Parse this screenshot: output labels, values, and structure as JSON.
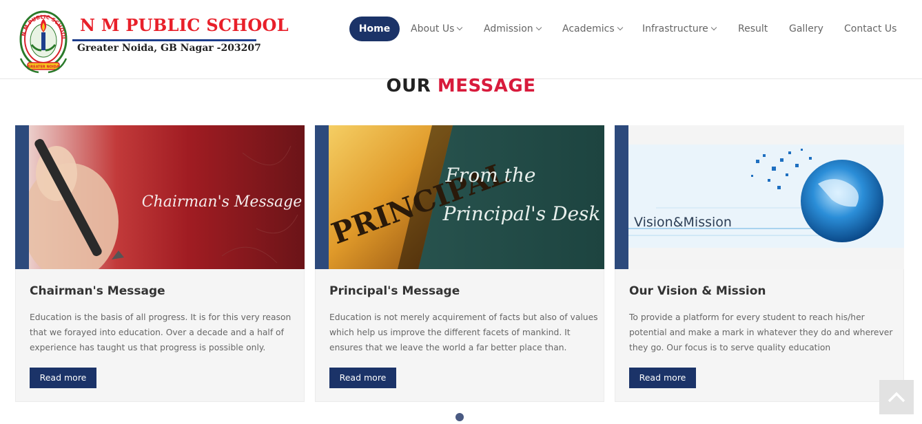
{
  "brand": {
    "name": "N M PUBLIC SCHOOL",
    "address": "Greater Noida, GB Nagar -203207",
    "emblem_text": "N M PUBLIC SCHOOL",
    "emblem_motto": "GREATER NOIDA"
  },
  "nav": {
    "items": [
      {
        "label": "Home",
        "active": true,
        "dropdown": false
      },
      {
        "label": "About Us",
        "active": false,
        "dropdown": true
      },
      {
        "label": "Admission",
        "active": false,
        "dropdown": true
      },
      {
        "label": "Academics",
        "active": false,
        "dropdown": true
      },
      {
        "label": "Infrastructure",
        "active": false,
        "dropdown": true
      },
      {
        "label": "Result",
        "active": false,
        "dropdown": false
      },
      {
        "label": "Gallery",
        "active": false,
        "dropdown": false
      },
      {
        "label": "Contact Us",
        "active": false,
        "dropdown": false
      }
    ]
  },
  "section": {
    "title_part1": "OUR",
    "title_part2": "MESSAGE"
  },
  "cards": [
    {
      "image_caption": "Chairman's Message",
      "title": "Chairman's Message",
      "text": "Education is the basis of all progress. It is for this very reason that we forayed into education. Over a decade and a half of experience has taught us that progress is possible only.",
      "button": "Read more"
    },
    {
      "image_caption_1": "PRINCIPAL",
      "image_caption_2": "From the",
      "image_caption_3": "Principal's Desk",
      "title": "Principal's Message",
      "text": "Education is not merely acquirement of facts but also of values which help us improve the different facets of mankind. It ensures that we leave the world a far better place than.",
      "button": "Read more"
    },
    {
      "image_caption": "Vision&Mission",
      "title": "Our Vision & Mission",
      "text": "To provide a platform for every student to reach his/her potential and make a mark in whatever they do and wherever they go. Our focus is to serve quality education",
      "button": "Read more"
    }
  ],
  "colors": {
    "brand_red": "#e8202a",
    "brand_blue": "#1d3e8c",
    "nav_active_bg": "#1b3368",
    "accent_red": "#d81b3c",
    "card_bar": "#2d4a7c"
  },
  "icons": {
    "dropdown": "chevron-down-icon",
    "back_to_top": "chevron-up-icon",
    "carousel": "carousel-dot-icon"
  }
}
